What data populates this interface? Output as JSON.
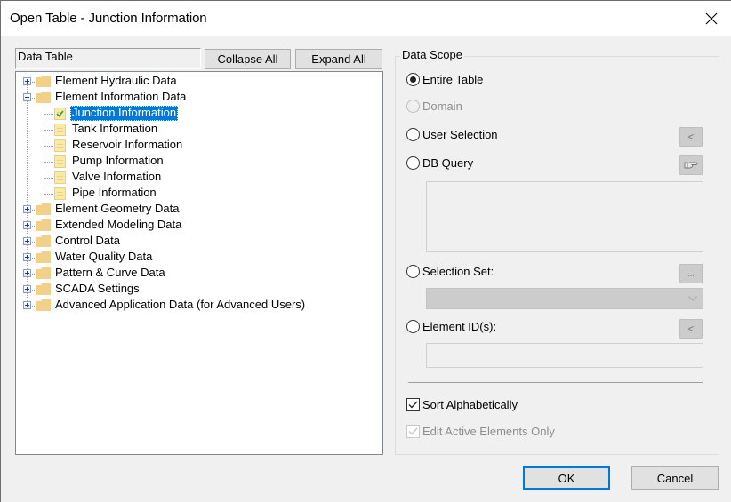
{
  "window": {
    "title": "Open Table - Junction Information",
    "close_icon": "close-x-icon"
  },
  "left_panel": {
    "header_label": "Data Table",
    "collapse_all_label": "Collapse All",
    "expand_all_label": "Expand All",
    "tree": [
      {
        "label": "Element Hydraulic Data",
        "type": "folder",
        "expanded": false
      },
      {
        "label": "Element Information Data",
        "type": "folder",
        "expanded": true,
        "children": [
          {
            "label": "Junction Information",
            "type": "table",
            "selected": true,
            "checked": true
          },
          {
            "label": "Tank Information",
            "type": "table"
          },
          {
            "label": "Reservoir Information",
            "type": "table"
          },
          {
            "label": "Pump Information",
            "type": "table"
          },
          {
            "label": "Valve Information",
            "type": "table"
          },
          {
            "label": "Pipe Information",
            "type": "table"
          }
        ]
      },
      {
        "label": "Element Geometry Data",
        "type": "folder",
        "expanded": false
      },
      {
        "label": "Extended Modeling Data",
        "type": "folder",
        "expanded": false
      },
      {
        "label": "Control Data",
        "type": "folder",
        "expanded": false
      },
      {
        "label": "Water Quality Data",
        "type": "folder",
        "expanded": false
      },
      {
        "label": "Pattern & Curve Data",
        "type": "folder",
        "expanded": false
      },
      {
        "label": "SCADA Settings",
        "type": "folder",
        "expanded": false
      },
      {
        "label": "Advanced Application Data (for Advanced Users)",
        "type": "folder",
        "expanded": false
      }
    ]
  },
  "data_scope": {
    "title": "Data Scope",
    "options": {
      "entire_table": {
        "label": "Entire Table",
        "checked": true,
        "enabled": true
      },
      "domain": {
        "label": "Domain",
        "checked": false,
        "enabled": false
      },
      "user_selection": {
        "label": "User Selection",
        "checked": false,
        "enabled": true,
        "button_label": "<"
      },
      "db_query": {
        "label": "DB Query",
        "checked": false,
        "enabled": true,
        "button_icon": "pointing-hand-icon",
        "query_text": ""
      },
      "selection_set": {
        "label": "Selection Set:",
        "checked": false,
        "enabled": true,
        "button_label": "...",
        "selected_value": ""
      },
      "element_ids": {
        "label": "Element ID(s):",
        "checked": false,
        "enabled": true,
        "button_label": "<",
        "value": ""
      }
    },
    "sort_alphabetically": {
      "label": "Sort Alphabetically",
      "checked": true,
      "enabled": true
    },
    "edit_active_only": {
      "label": "Edit Active Elements Only",
      "checked": true,
      "enabled": false
    }
  },
  "footer": {
    "ok_label": "OK",
    "cancel_label": "Cancel"
  },
  "colors": {
    "selection": "#0078d7",
    "folder": "#f0d08a",
    "focus_border": "#0078d7"
  }
}
